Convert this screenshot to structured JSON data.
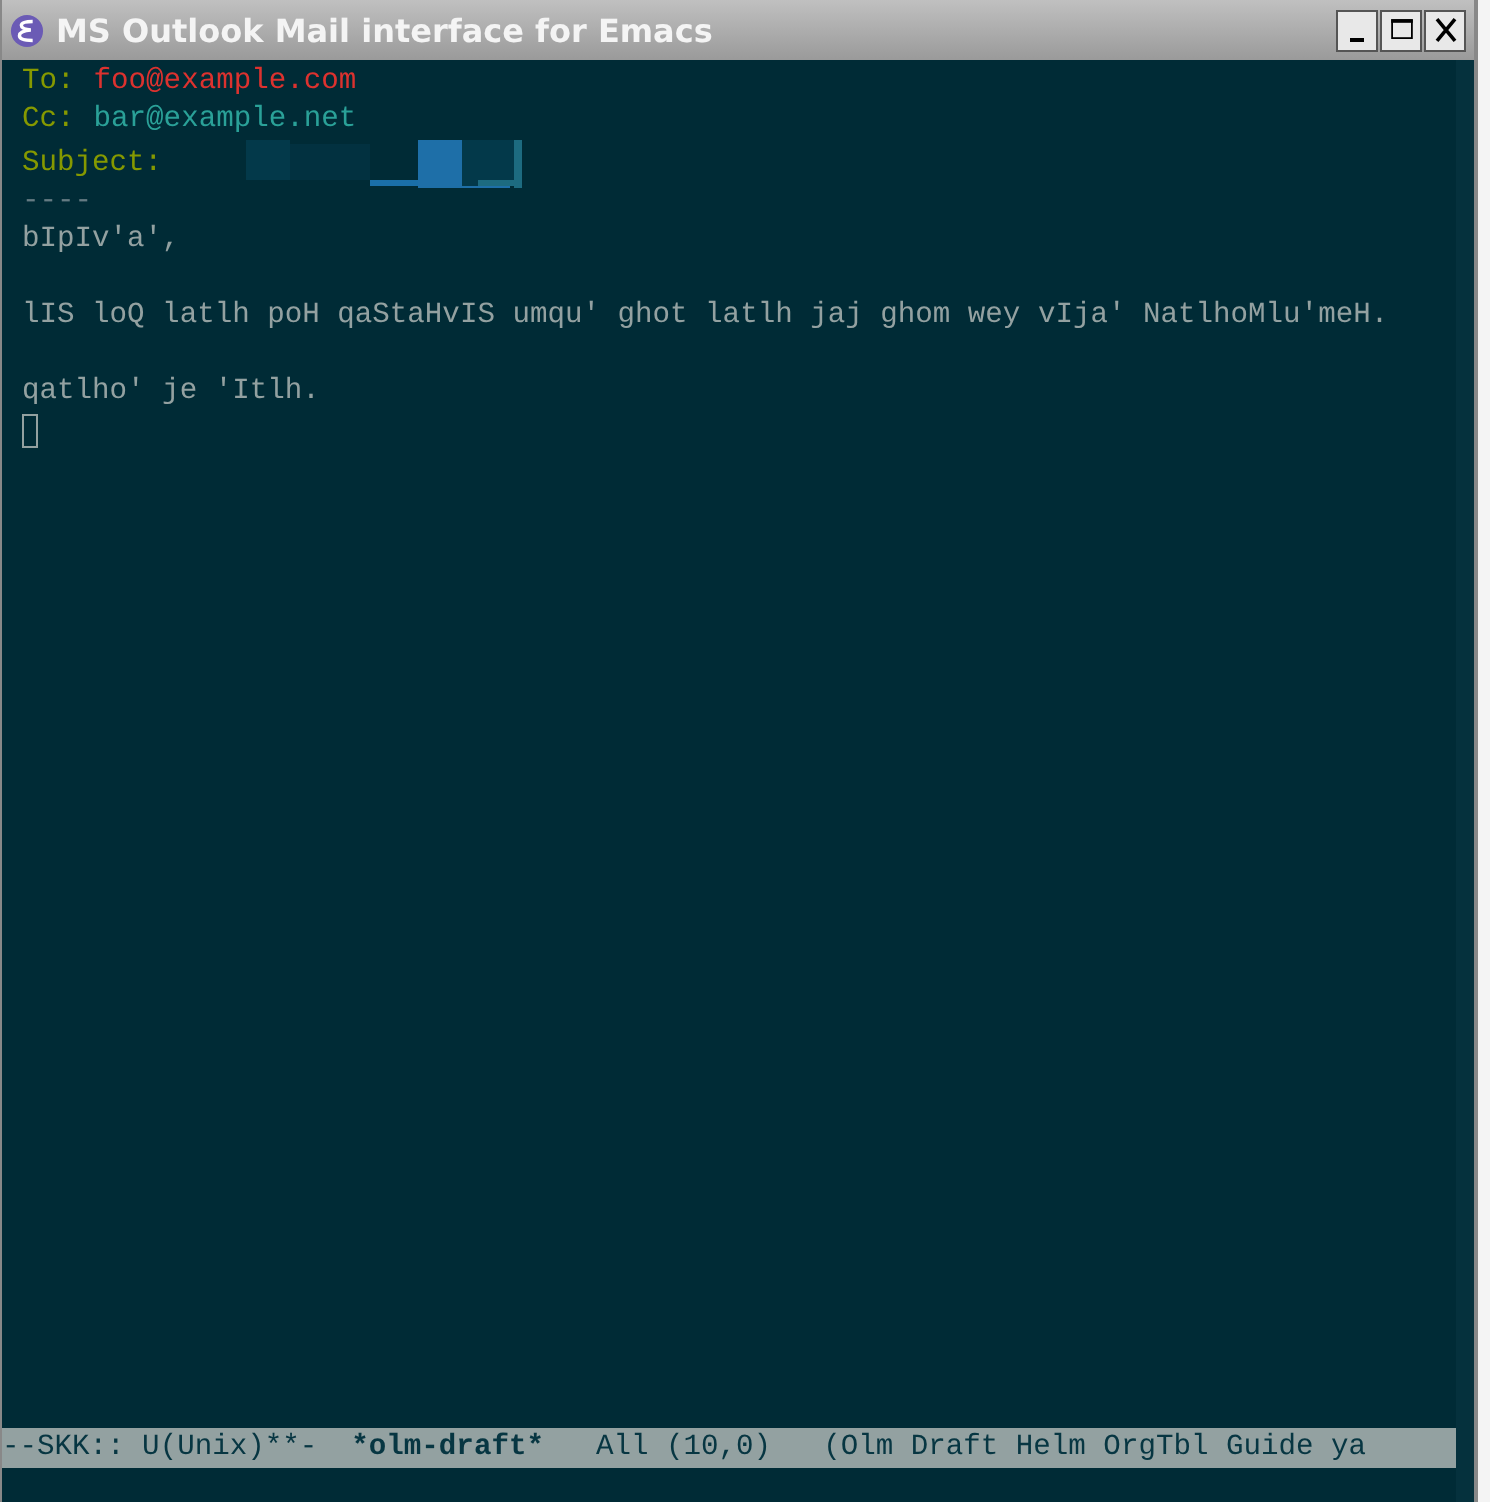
{
  "window": {
    "title": "MS Outlook Mail interface for Emacs"
  },
  "headers": [
    {
      "kind": "to",
      "label": "To:",
      "value": "foo@example.com"
    },
    {
      "kind": "cc",
      "label": "Cc:",
      "value": "bar@example.net"
    },
    {
      "kind": "subject",
      "label": "Subject:"
    }
  ],
  "separator": "----",
  "body": [
    "bIpIv'a',",
    "lIS loQ latlh poH qaStaHvIS umqu' ghot latlh jaj ghom wey vIja' NatlhoMlu'meH.",
    "qatlho' je 'Itlh."
  ],
  "mode_line": {
    "status": "--SKK:: U(Unix)**-",
    "buffer": "*olm-draft*",
    "position": "All (10,0)",
    "modes": "(Olm Draft Helm OrgTbl Guide ya"
  }
}
